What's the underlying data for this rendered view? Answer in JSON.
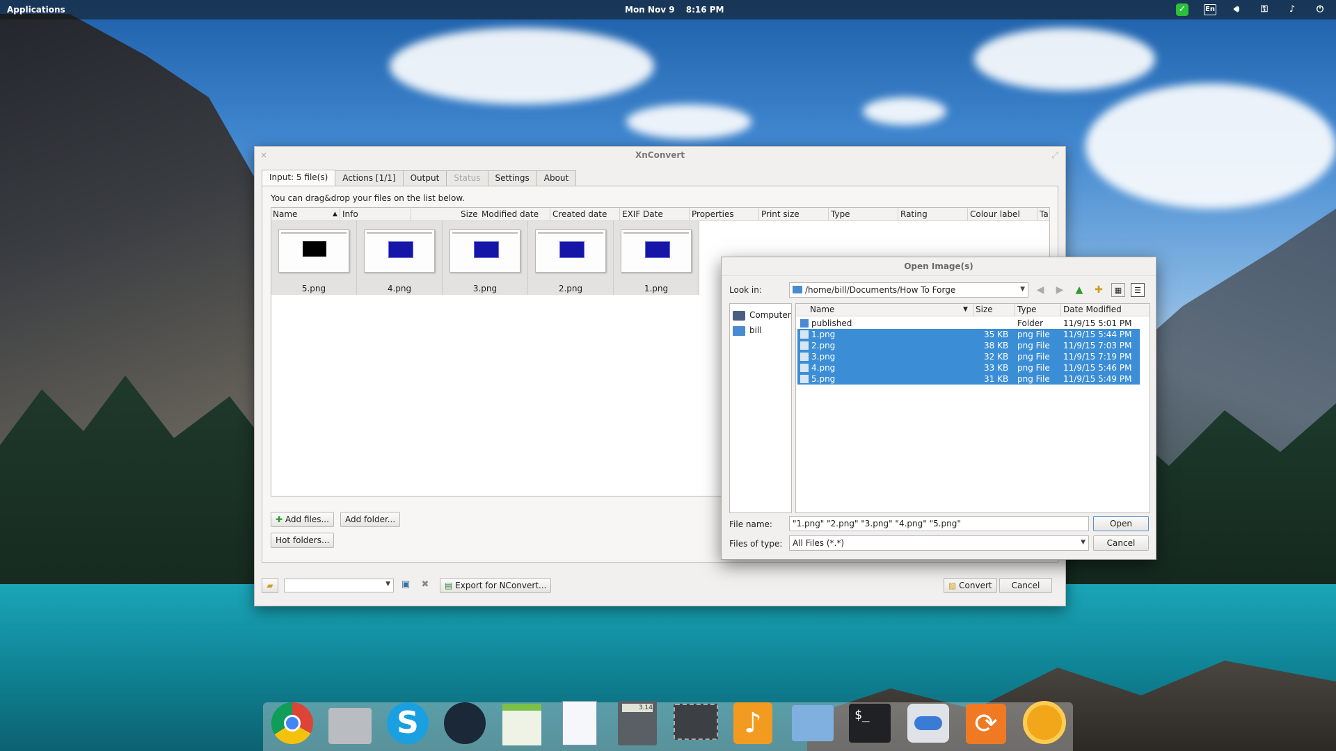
{
  "top_panel": {
    "applications_label": "Applications",
    "date": "Mon Nov 9",
    "time": "8:16 PM",
    "keyboard_layout": "En"
  },
  "xnconvert": {
    "title": "XnConvert",
    "tabs": [
      {
        "label": "Input: 5 file(s)",
        "active": true
      },
      {
        "label": "Actions [1/1]"
      },
      {
        "label": "Output"
      },
      {
        "label": "Status",
        "disabled": true
      },
      {
        "label": "Settings"
      },
      {
        "label": "About"
      }
    ],
    "hint": "You can drag&drop your files on the list below.",
    "columns": [
      "Name",
      "Info",
      "Size",
      "Modified date",
      "Created date",
      "EXIF Date",
      "Properties",
      "Print size",
      "Type",
      "Rating",
      "Colour label",
      "Ta"
    ],
    "thumbnails": [
      {
        "name": "5.png",
        "style": "black"
      },
      {
        "name": "4.png",
        "style": "blue"
      },
      {
        "name": "3.png",
        "style": "blue"
      },
      {
        "name": "2.png",
        "style": "blue"
      },
      {
        "name": "1.png",
        "style": "blue"
      }
    ],
    "buttons": {
      "add_files": "Add files...",
      "add_folder": "Add folder...",
      "hot_folders": "Hot folders...",
      "export": "Export for NConvert...",
      "convert": "Convert",
      "cancel": "Cancel"
    }
  },
  "open_dialog": {
    "title": "Open Image(s)",
    "look_in_label": "Look in:",
    "look_in_value": "/home/bill/Documents/How To Forge",
    "sidebar": [
      {
        "label": "Computer",
        "icon": "computer-icon"
      },
      {
        "label": "bill",
        "icon": "folder-icon"
      }
    ],
    "columns": [
      "Name",
      "Size",
      "Type",
      "Date Modified"
    ],
    "files": [
      {
        "name": "published",
        "size": "",
        "type": "Folder",
        "date": "11/9/15 5:01 PM",
        "selected": false
      },
      {
        "name": "1.png",
        "size": "35 KB",
        "type": "png File",
        "date": "11/9/15 5:44 PM",
        "selected": true
      },
      {
        "name": "2.png",
        "size": "38 KB",
        "type": "png File",
        "date": "11/9/15 7:03 PM",
        "selected": true
      },
      {
        "name": "3.png",
        "size": "32 KB",
        "type": "png File",
        "date": "11/9/15 7:19 PM",
        "selected": true
      },
      {
        "name": "4.png",
        "size": "33 KB",
        "type": "png File",
        "date": "11/9/15 5:46 PM",
        "selected": true
      },
      {
        "name": "5.png",
        "size": "31 KB",
        "type": "png File",
        "date": "11/9/15 5:49 PM",
        "selected": true
      }
    ],
    "file_name_label": "File name:",
    "file_name_value": "\"1.png\" \"2.png\" \"3.png\" \"4.png\" \"5.png\"",
    "files_of_type_label": "Files of type:",
    "files_of_type_value": "All Files (*.*)",
    "open_button": "Open",
    "cancel_button": "Cancel"
  },
  "calculator_dock_readout": "3.14",
  "colors": {
    "selection": "#3b8ed6",
    "window_bg": "#f1f0ee",
    "panel_bg": "#1f1f1f"
  }
}
